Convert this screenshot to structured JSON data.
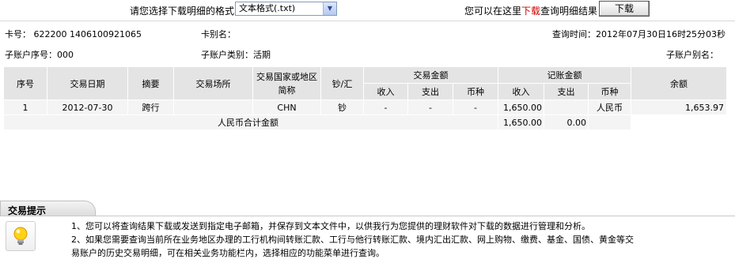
{
  "topbar": {
    "download_prompt": "请您选择下载明细的格式",
    "format_selected": "文本格式(.txt)",
    "hint_before": "您可以在这里",
    "hint_red": "下载",
    "hint_after": "查询明细结果",
    "download_button": "下载"
  },
  "meta": {
    "card_no": "卡号： 622200 1406100921065",
    "card_alias": "卡别名：",
    "query_time": "查询时间：2012年07月30日16时25分03秒",
    "sub_account_no": "子账户序号：000",
    "sub_account_type": "子账户类别：活期",
    "sub_account_alias": "子账户别名："
  },
  "table": {
    "headers": {
      "seq": "序号",
      "date": "交易日期",
      "summary": "摘要",
      "place": "交易场所",
      "country": "交易国家或地区简称",
      "cash": "钞/汇",
      "trade_amount": "交易金额",
      "book_amount": "记账金额",
      "income": "收入",
      "expense": "支出",
      "currency": "币种",
      "balance": "余额"
    },
    "row": {
      "seq": "1",
      "date": "2012-07-30",
      "summary": "跨行",
      "place": "",
      "country": "CHN",
      "cash": "钞",
      "t_income": "-",
      "t_expense": "-",
      "t_currency": "-",
      "b_income": "1,650.00",
      "b_expense": "",
      "b_currency": "人民币",
      "balance": "1,653.97"
    },
    "total": {
      "label": "人民币合计金额",
      "income": "1,650.00",
      "expense": "0.00"
    }
  },
  "tips": {
    "title": "交易提示",
    "line1": "1、您可以将查询结果下载或发送到指定电子邮箱，并保存到文本文件中，以供我行为您提供的理财软件对下载的数据进行管理和分析。",
    "line2": "2、如果您需要查询当前所在业务地区办理的工行机构间转账汇款、工行与他行转账汇款、境内汇出汇款、网上购物、缴费、基金、国债、黄金等交",
    "line3": "易账户的历史交易明细，可在相关业务功能栏内，选择相应的功能菜单进行查询。"
  }
}
